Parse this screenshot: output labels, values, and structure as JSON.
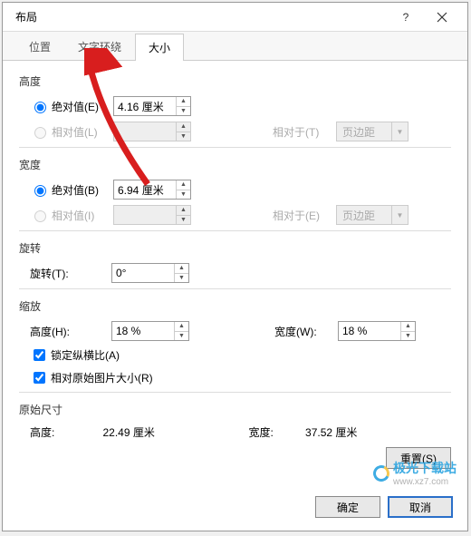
{
  "title": "布局",
  "tabs": {
    "position": "位置",
    "wrap": "文字环绕",
    "size": "大小"
  },
  "height": {
    "title": "高度",
    "absolute_label": "绝对值(E)",
    "absolute_value": "4.16 厘米",
    "relative_label": "相对值(L)",
    "relative_value": "",
    "relative_to_label": "相对于(T)",
    "relative_to_value": "页边距"
  },
  "width": {
    "title": "宽度",
    "absolute_label": "绝对值(B)",
    "absolute_value": "6.94 厘米",
    "relative_label": "相对值(I)",
    "relative_value": "",
    "relative_to_label": "相对于(E)",
    "relative_to_value": "页边距"
  },
  "rotation": {
    "title": "旋转",
    "label": "旋转(T):",
    "value": "0°"
  },
  "scale": {
    "title": "缩放",
    "h_label": "高度(H):",
    "h_value": "18 %",
    "w_label": "宽度(W):",
    "w_value": "18 %",
    "lock_label": "锁定纵横比(A)",
    "orig_label": "相对原始图片大小(R)"
  },
  "original": {
    "title": "原始尺寸",
    "h_label": "高度:",
    "h_value": "22.49 厘米",
    "w_label": "宽度:",
    "w_value": "37.52 厘米"
  },
  "buttons": {
    "reset": "重置(S)",
    "ok": "确定",
    "cancel": "取消"
  },
  "watermark": {
    "name": "极光下载站",
    "url": "www.xz7.com"
  }
}
